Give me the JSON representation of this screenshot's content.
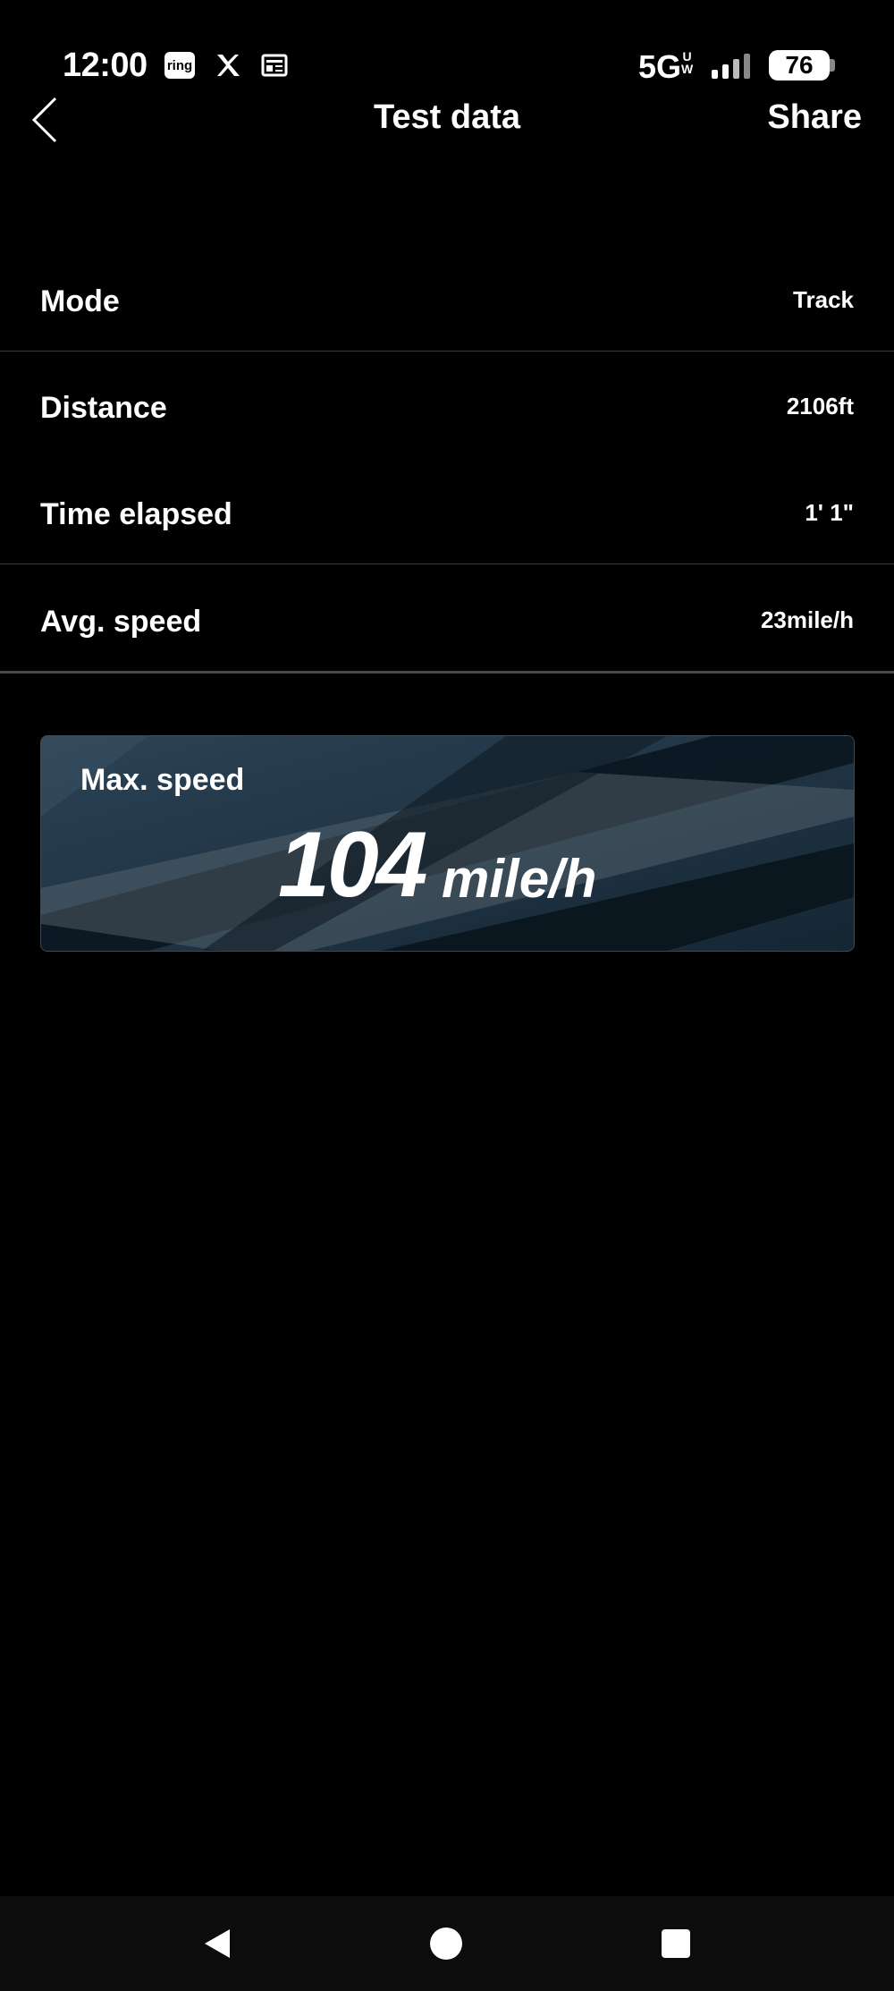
{
  "status_bar": {
    "time": "12:00",
    "ring_icon_text": "ring",
    "network": "5G",
    "network_sub": "UW",
    "battery": "76",
    "icons": [
      "ring-icon",
      "x-icon",
      "news-icon",
      "signal-icon",
      "battery-icon"
    ]
  },
  "header": {
    "back_icon": "chevron-left-icon",
    "title": "Test data",
    "share_label": "Share"
  },
  "rows": [
    {
      "label": "Mode",
      "value": "Track"
    },
    {
      "label": "Distance",
      "value": "2106ft"
    },
    {
      "label": "Time elapsed",
      "value": "1' 1\""
    },
    {
      "label": "Avg. speed",
      "value": "23mile/h"
    }
  ],
  "max_speed": {
    "label": "Max. speed",
    "value": "104",
    "unit": "mile/h"
  },
  "nav": {
    "icons": [
      "back-triangle-icon",
      "home-circle-icon",
      "recents-square-icon"
    ]
  },
  "colors": {
    "background": "#000000",
    "card_bg": "#1f3445",
    "divider": "#3a3a3a"
  }
}
